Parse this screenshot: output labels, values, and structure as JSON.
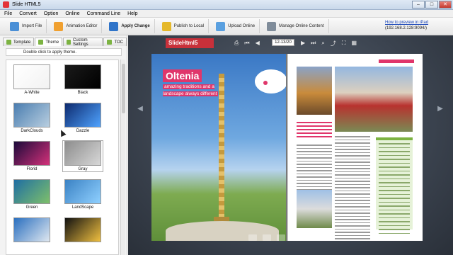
{
  "window": {
    "title": "Slide HTML5"
  },
  "window_buttons": [
    "–",
    "□",
    "✕"
  ],
  "menu": [
    "File",
    "Convert",
    "Option",
    "Online",
    "Command Line",
    "Help"
  ],
  "toolbar": {
    "buttons": [
      {
        "label": "Import File",
        "icon": "import-icon",
        "color": "#4a8fd6"
      },
      {
        "label": "Animation Editor",
        "icon": "animation-icon",
        "color": "#f0a030"
      },
      {
        "label": "Apply Change",
        "icon": "apply-icon",
        "color": "#2f74c9"
      },
      {
        "label": "Publish to Local",
        "icon": "publish-icon",
        "color": "#e5b82a"
      },
      {
        "label": "Upload Online",
        "icon": "upload-icon",
        "color": "#5aa0e0"
      },
      {
        "label": "Manage Online Content",
        "icon": "manage-icon",
        "color": "#7f8c9a"
      }
    ],
    "preview_link": "How to preview in iPad",
    "ip": "(192.168.2.128:9094/)"
  },
  "left_panel": {
    "tabs": [
      "Template",
      "Theme",
      "Custom Settings",
      "TOC"
    ],
    "active_tab": "Theme",
    "hint": "Double click to apply theme.",
    "themes": [
      {
        "name": "A-White",
        "colors": [
          "#ffffff",
          "#f2f2f2"
        ]
      },
      {
        "name": "Black",
        "colors": [
          "#1a1a1a",
          "#000000"
        ]
      },
      {
        "name": "DarkClouds",
        "colors": [
          "#4a7db0",
          "#b9cfe0"
        ]
      },
      {
        "name": "Dazzle",
        "colors": [
          "#0d2a6e",
          "#4fa3ff"
        ]
      },
      {
        "name": "Florid",
        "colors": [
          "#1b0a3a",
          "#d4317a"
        ]
      },
      {
        "name": "Gray",
        "colors": [
          "#8d8d8d",
          "#d8d8d8"
        ]
      },
      {
        "name": "Green",
        "colors": [
          "#1f6ea3",
          "#7ec06a"
        ]
      },
      {
        "name": "LandScape",
        "colors": [
          "#3b82c4",
          "#8fd0ff"
        ]
      },
      {
        "name": "",
        "colors": [
          "#2a6fbf",
          "#e0e8f0"
        ]
      },
      {
        "name": "",
        "colors": [
          "#111111",
          "#f0c040"
        ]
      }
    ],
    "selected_theme": "Gray"
  },
  "book": {
    "brand": "SlideHtml5",
    "page_number": "12-13/20",
    "title": "Oltenia",
    "subtitle": "amazing traditions and a landscape always different"
  },
  "colors": {
    "accent": "#e0366b",
    "brand": "#c8303a",
    "green": "#7cb342"
  }
}
